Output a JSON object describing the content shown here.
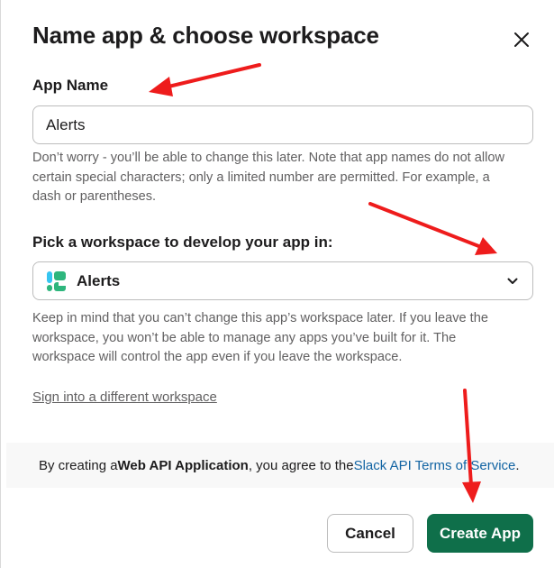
{
  "dialog": {
    "title": "Name app & choose workspace"
  },
  "app_name": {
    "label": "App Name",
    "value": "Alerts",
    "help": "Don’t worry - you’ll be able to change this later. Note that app names do not allow certain special characters; only a limited number are permitted. For example, a dash or parentheses."
  },
  "workspace": {
    "label": "Pick a workspace to develop your app in:",
    "selected": "Alerts",
    "help": "Keep in mind that you can’t change this app’s workspace later. If you leave the workspace, you won’t be able to manage any apps you’ve built for it. The workspace will control the app even if you leave the workspace.",
    "switch_link": "Sign into a different workspace"
  },
  "terms": {
    "prefix": "By creating a ",
    "bold": "Web API Application",
    "middle": ", you agree to the ",
    "link": "Slack API Terms of Service",
    "suffix": "."
  },
  "buttons": {
    "cancel": "Cancel",
    "create": "Create App"
  },
  "colors": {
    "primary": "#0f6f4a",
    "link": "#1264a3",
    "annotation_arrow": "#ee1c1c"
  }
}
